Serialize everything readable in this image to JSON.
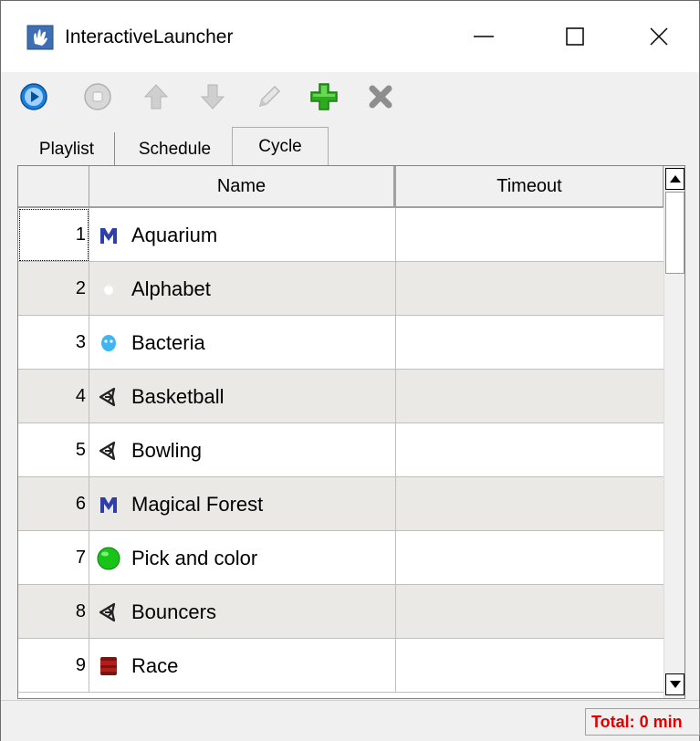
{
  "window": {
    "title": "InteractiveLauncher"
  },
  "toolbar": {
    "buttons": [
      {
        "name": "play",
        "icon": "play-icon"
      },
      {
        "name": "stop",
        "icon": "stop-icon"
      },
      {
        "name": "move-up",
        "icon": "arrow-up-icon"
      },
      {
        "name": "move-down",
        "icon": "arrow-down-icon"
      },
      {
        "name": "edit",
        "icon": "pencil-icon"
      },
      {
        "name": "add",
        "icon": "plus-icon"
      },
      {
        "name": "delete",
        "icon": "x-icon"
      }
    ]
  },
  "tabs": [
    {
      "label": "Playlist"
    },
    {
      "label": "Schedule"
    },
    {
      "label": "Cycle",
      "active": true
    }
  ],
  "grid": {
    "columns": {
      "num": "",
      "name": "Name",
      "timeout": "Timeout"
    },
    "rows": [
      {
        "num": "1",
        "name": "Aquarium",
        "timeout": "",
        "icon": "m-logo-icon"
      },
      {
        "num": "2",
        "name": "Alphabet",
        "timeout": "",
        "icon": "apple-icon"
      },
      {
        "num": "3",
        "name": "Bacteria",
        "timeout": "",
        "icon": "bacteria-icon"
      },
      {
        "num": "4",
        "name": "Basketball",
        "timeout": "",
        "icon": "unity-icon"
      },
      {
        "num": "5",
        "name": "Bowling",
        "timeout": "",
        "icon": "unity-icon"
      },
      {
        "num": "6",
        "name": "Magical Forest",
        "timeout": "",
        "icon": "m-logo-icon"
      },
      {
        "num": "7",
        "name": "Pick and color",
        "timeout": "",
        "icon": "green-ball-icon"
      },
      {
        "num": "8",
        "name": "Bouncers",
        "timeout": "",
        "icon": "unity-icon"
      },
      {
        "num": "9",
        "name": "Race",
        "timeout": "",
        "icon": "red-drum-icon"
      }
    ]
  },
  "status": {
    "total": "Total: 0 min"
  },
  "colors": {
    "alt_row": "#ebe9e5",
    "total_text": "#e00000",
    "add_green": "#2eaa1e",
    "play_blue": "#1f7fd8"
  }
}
